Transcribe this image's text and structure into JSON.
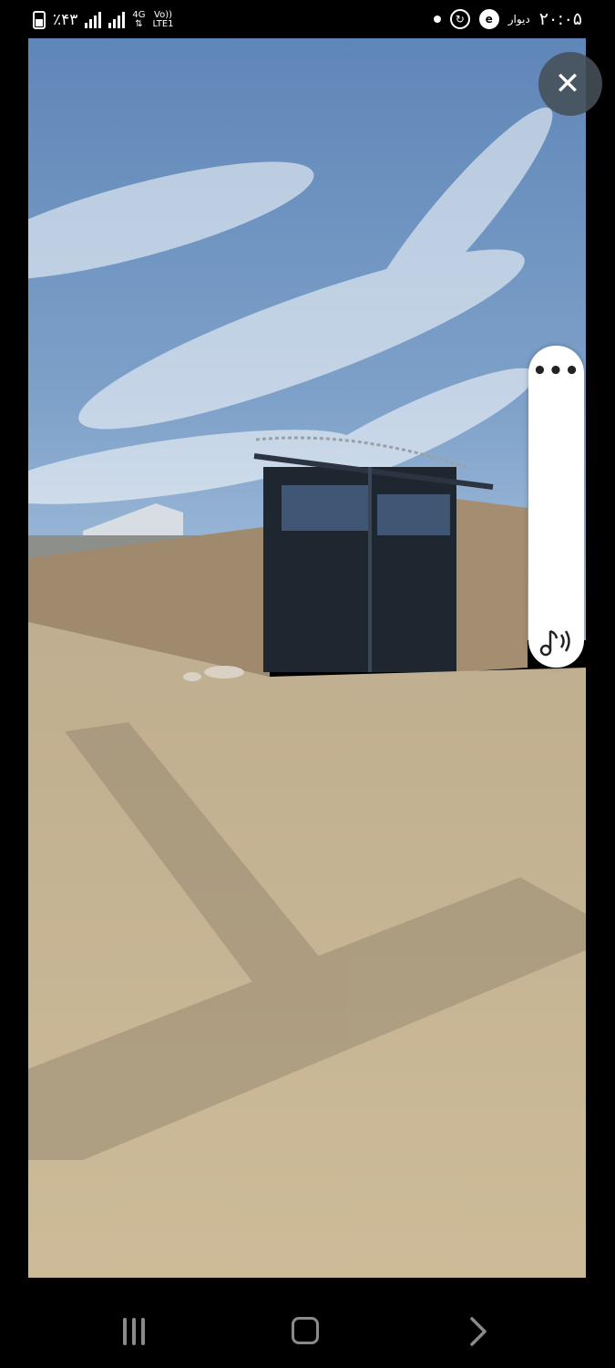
{
  "status_bar": {
    "battery_text": "٪۴۳",
    "network_type": "4G",
    "volte": "Vo))",
    "lte": "LTE1",
    "app_label": "دیوار",
    "time": "۲۰:۰۵"
  },
  "viewer": {
    "close_glyph": "✕",
    "more_glyph": "•••"
  },
  "icons": {
    "battery": "battery-icon",
    "signal": "signal-icon",
    "close": "close-icon",
    "more": "more-horizontal-icon",
    "sound": "sound-icon",
    "recents": "recents-icon",
    "home": "home-icon",
    "back": "back-icon"
  },
  "colors": {
    "sky_top": "#5f86b8",
    "sky_bottom": "#a9c2dd",
    "ground": "#c9b896",
    "wall": "#a08a6e",
    "gate": "#1e2630",
    "overlay": "#464e58"
  }
}
